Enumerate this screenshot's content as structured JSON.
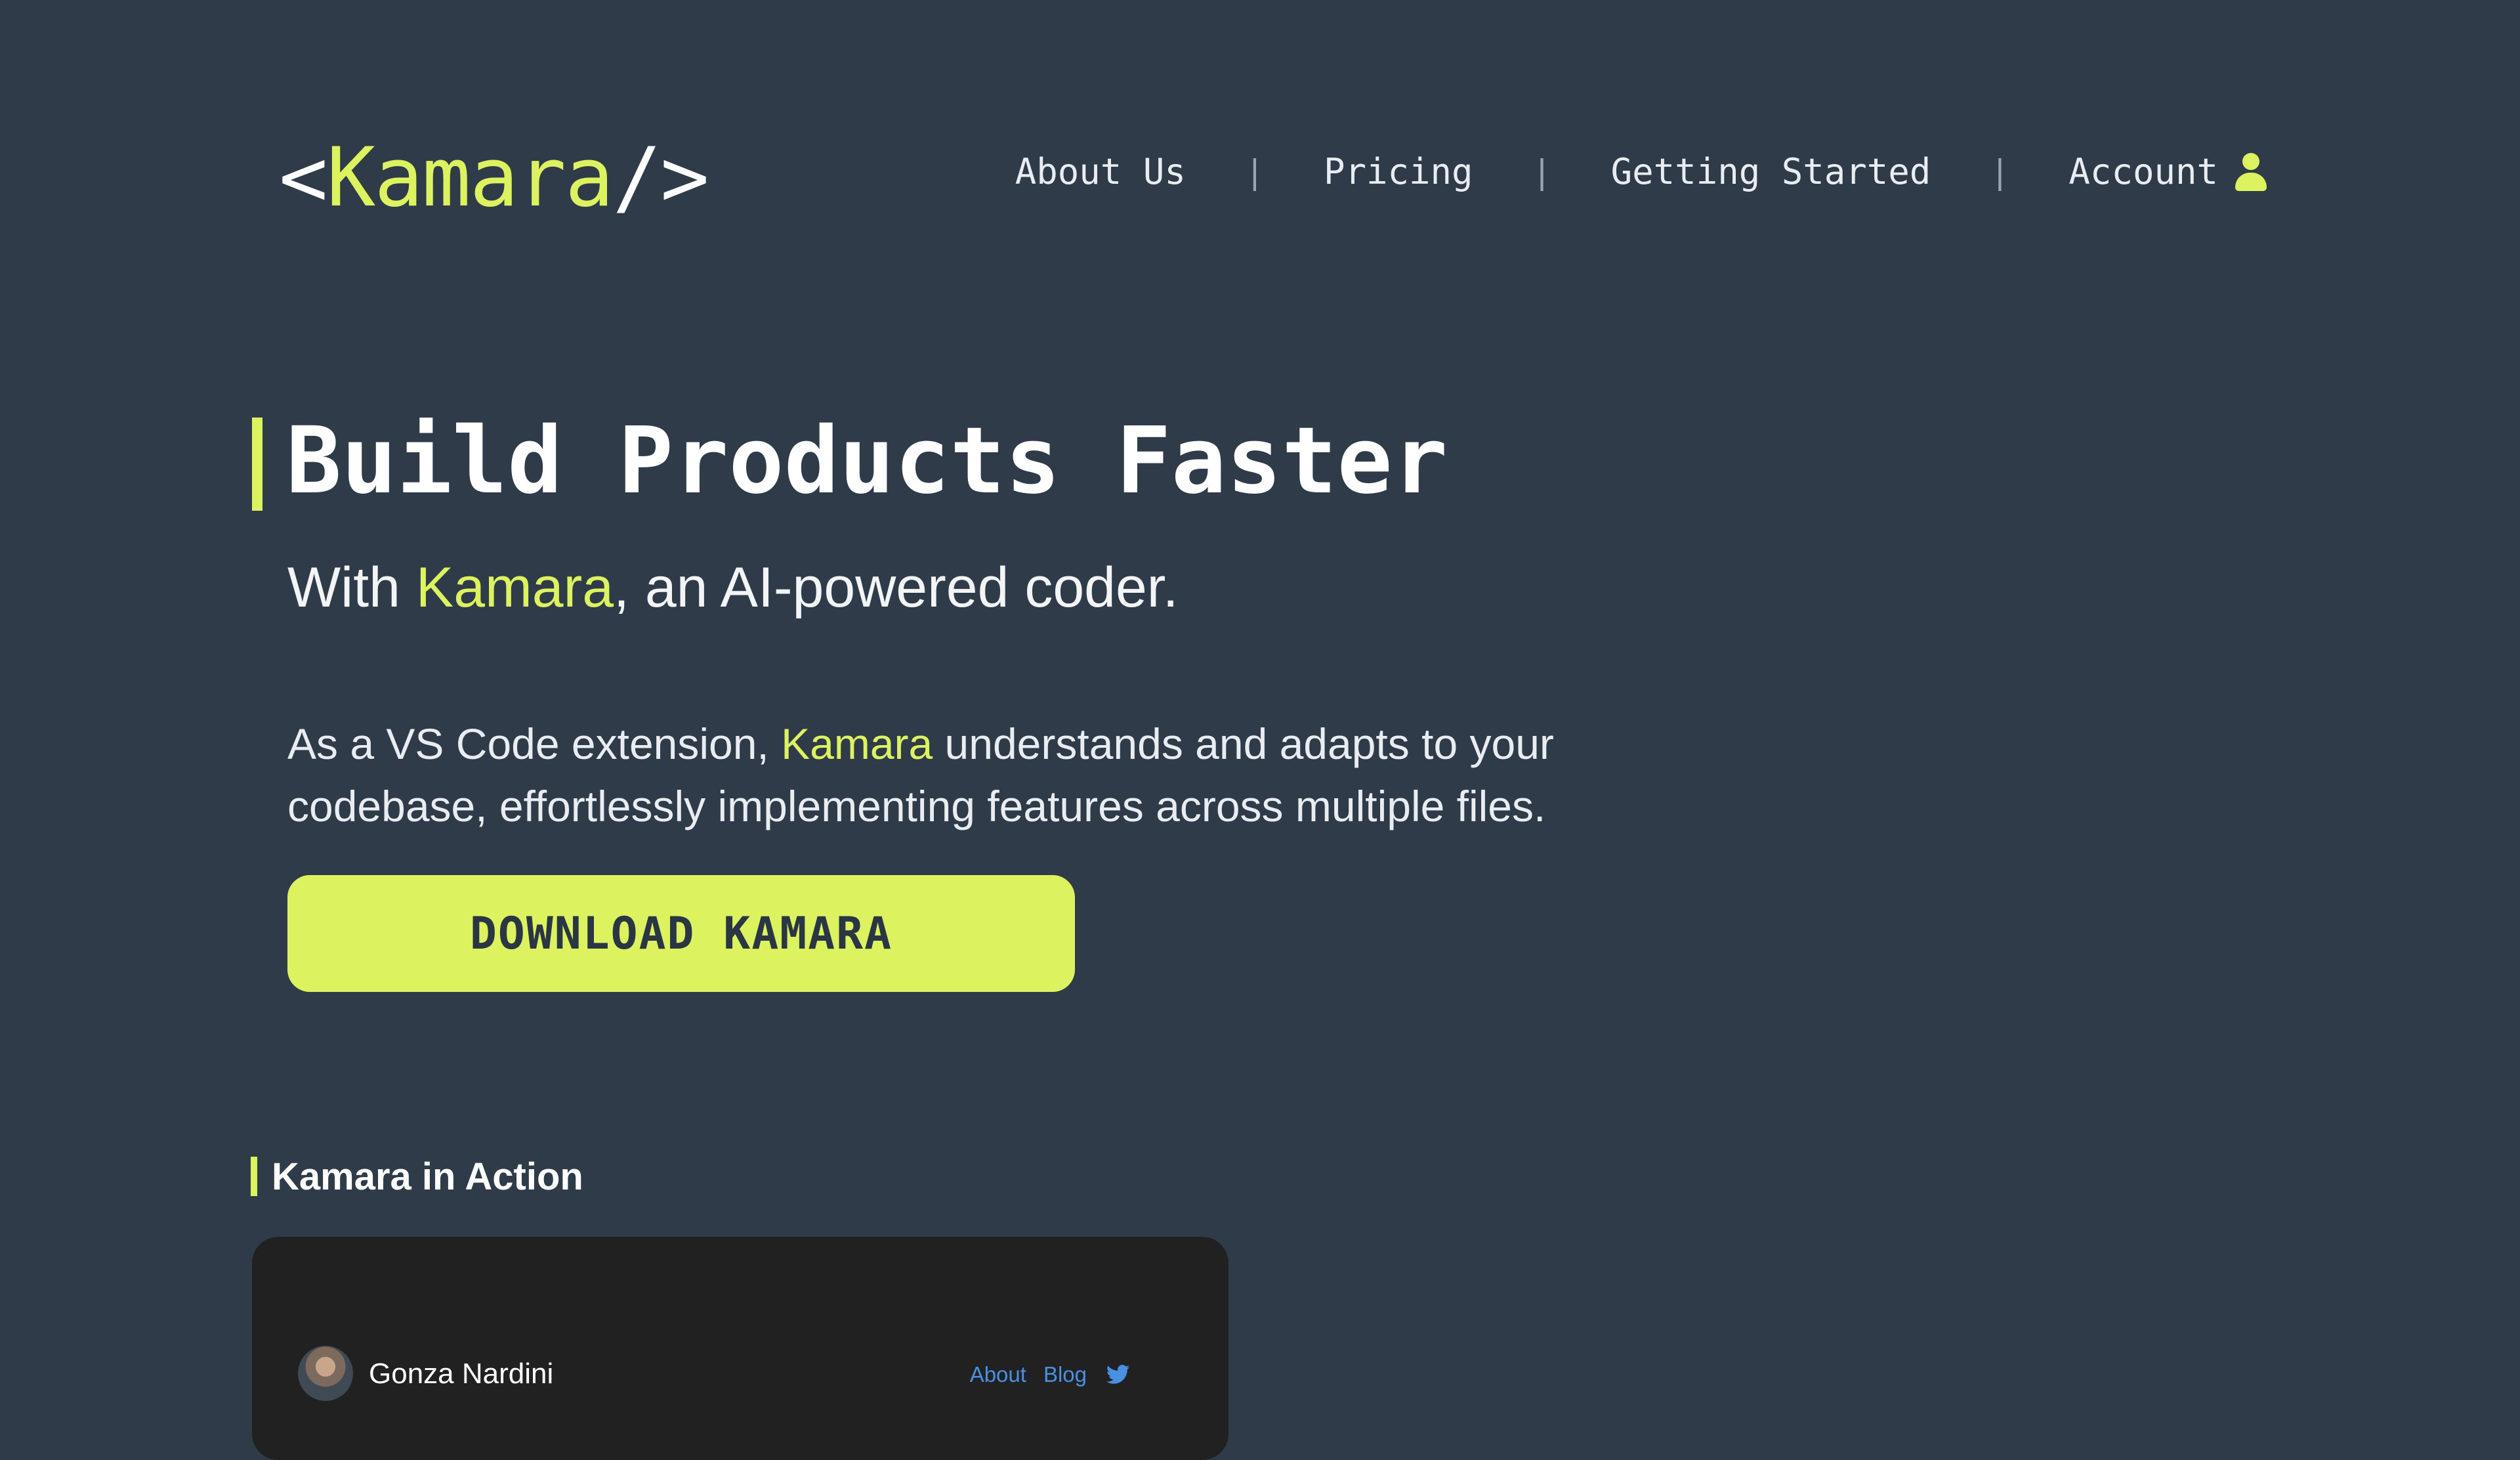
{
  "header": {
    "logo": {
      "open": "<",
      "name": "Kamara",
      "close": "/>"
    },
    "nav": [
      {
        "label": "About Us"
      },
      {
        "label": "Pricing"
      },
      {
        "label": "Getting Started"
      },
      {
        "label": "Account",
        "icon": "user-icon"
      }
    ],
    "separator": "|"
  },
  "hero": {
    "title": "Build Products Faster",
    "subtitle": {
      "prefix": "With ",
      "brand": "Kamara",
      "suffix": ", an AI-powered coder."
    },
    "description": {
      "prefix": "As a VS Code extension, ",
      "brand": "Kamara",
      "suffix": " understands and adapts to your codebase, effortlessly implementing features across multiple files."
    },
    "cta_label": "DOWNLOAD KAMARA"
  },
  "section": {
    "title": "Kamara in Action"
  },
  "preview": {
    "name": "Gonza Nardini",
    "links": [
      "About",
      "Blog"
    ],
    "social_icon": "twitter-icon"
  },
  "colors": {
    "background": "#2f3b49",
    "accent": "#dcf25f",
    "card": "#212121",
    "link": "#4a90e2"
  }
}
